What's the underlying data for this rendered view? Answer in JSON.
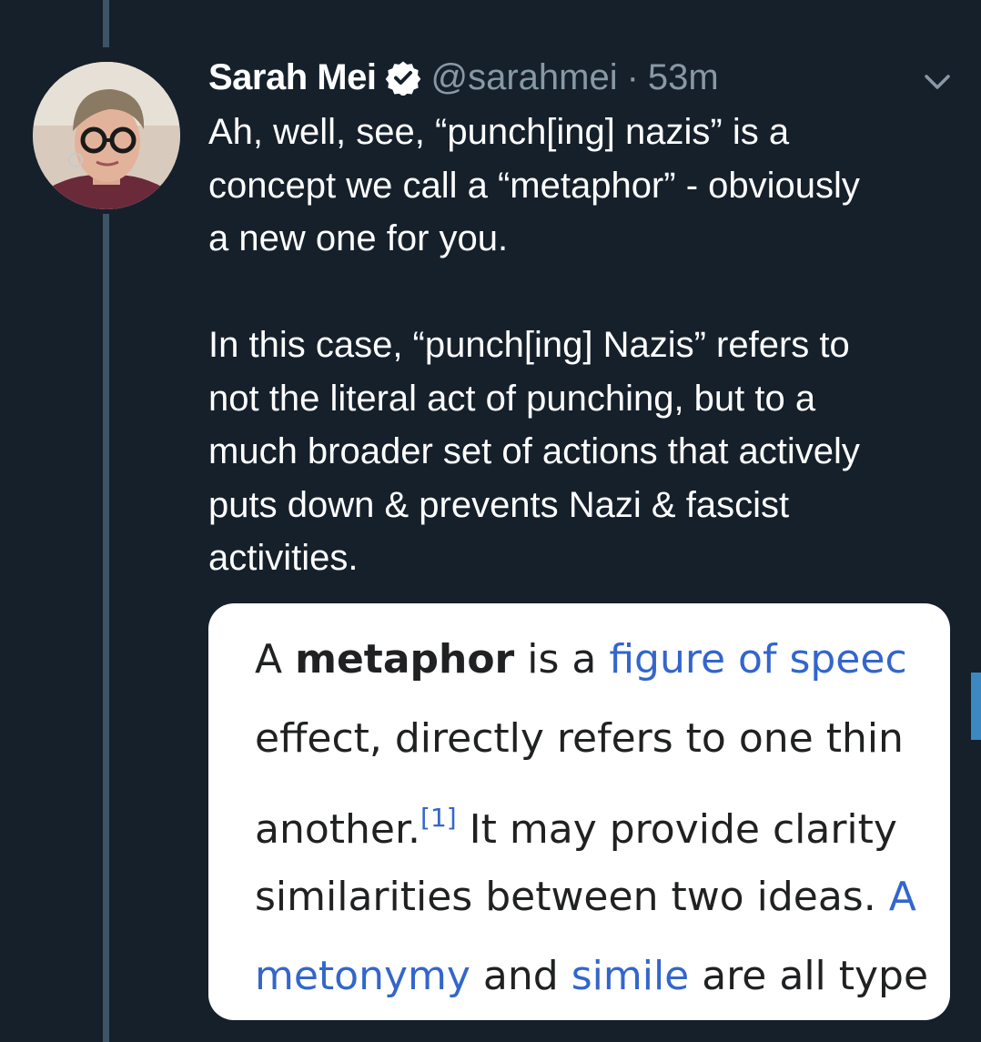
{
  "tweet": {
    "display_name": "Sarah Mei",
    "handle": "@sarahmei",
    "separator": "·",
    "time": "53m",
    "paragraphs": [
      "Ah, well, see, “punch[ing] nazis” is a\nconcept we call a “metaphor” - obviously\na new one for you.",
      "In this case, “punch[ing] Nazis” refers to\nnot the literal act of punching, but to a\nmuch broader set of actions that actively\nputs down & prevents Nazi & fascist\nactivities."
    ]
  },
  "icons": {
    "verified": "verified-badge-icon",
    "menu": "chevron-down-icon",
    "avatar": "profile-photo"
  },
  "media": {
    "line1": {
      "a": "A ",
      "term": "metaphor",
      "b": " is a ",
      "link": "figure of speec"
    },
    "line2": {
      "text": "effect, directly refers to one thin"
    },
    "line3": {
      "a": "another.",
      "ref": "[1]",
      "b": " It may provide clarity"
    },
    "line4": {
      "a": "similarities between two ideas. ",
      "link": "A"
    },
    "line5": {
      "link1": "metonymy",
      "a": " and ",
      "link2": "simile",
      "b": " are all type"
    }
  },
  "colors": {
    "background": "#15202b",
    "thread_line": "#3d5466",
    "secondary_text": "#8899a6",
    "verified": "#ffffff",
    "wiki_link": "#3366cc"
  }
}
